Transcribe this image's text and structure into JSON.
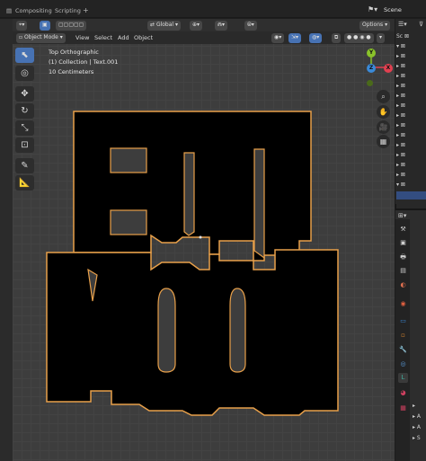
{
  "workspace_tabs": [
    "Compositing",
    "Scripting"
  ],
  "add_tab": "+",
  "scene": {
    "icon": "scene-icon",
    "label": "Scene"
  },
  "header": {
    "mode_label": "Object Mode",
    "menus": [
      "View",
      "Select",
      "Add",
      "Object"
    ],
    "orientation": "Global",
    "options_label": "Options"
  },
  "overlay": {
    "view_name": "Top Orthographic",
    "collection": "(1) Collection | Text.001",
    "scale": "10 Centimeters"
  },
  "gizmo": {
    "y": "Y",
    "x": "X",
    "z": "Z"
  },
  "colors": {
    "accent": "#4772b3",
    "selection_outline": "#e8a04a",
    "axis_x": "#e04050",
    "axis_y": "#8ac32a",
    "axis_z": "#3a8ad8"
  },
  "outliner": {
    "rows": [
      "Sc",
      "",
      "",
      "",
      "",
      "",
      "",
      "",
      "",
      "",
      "",
      "",
      "",
      "",
      "",
      "",
      "",
      ""
    ]
  },
  "properties": {
    "items": [
      "A",
      "A",
      "S"
    ]
  }
}
